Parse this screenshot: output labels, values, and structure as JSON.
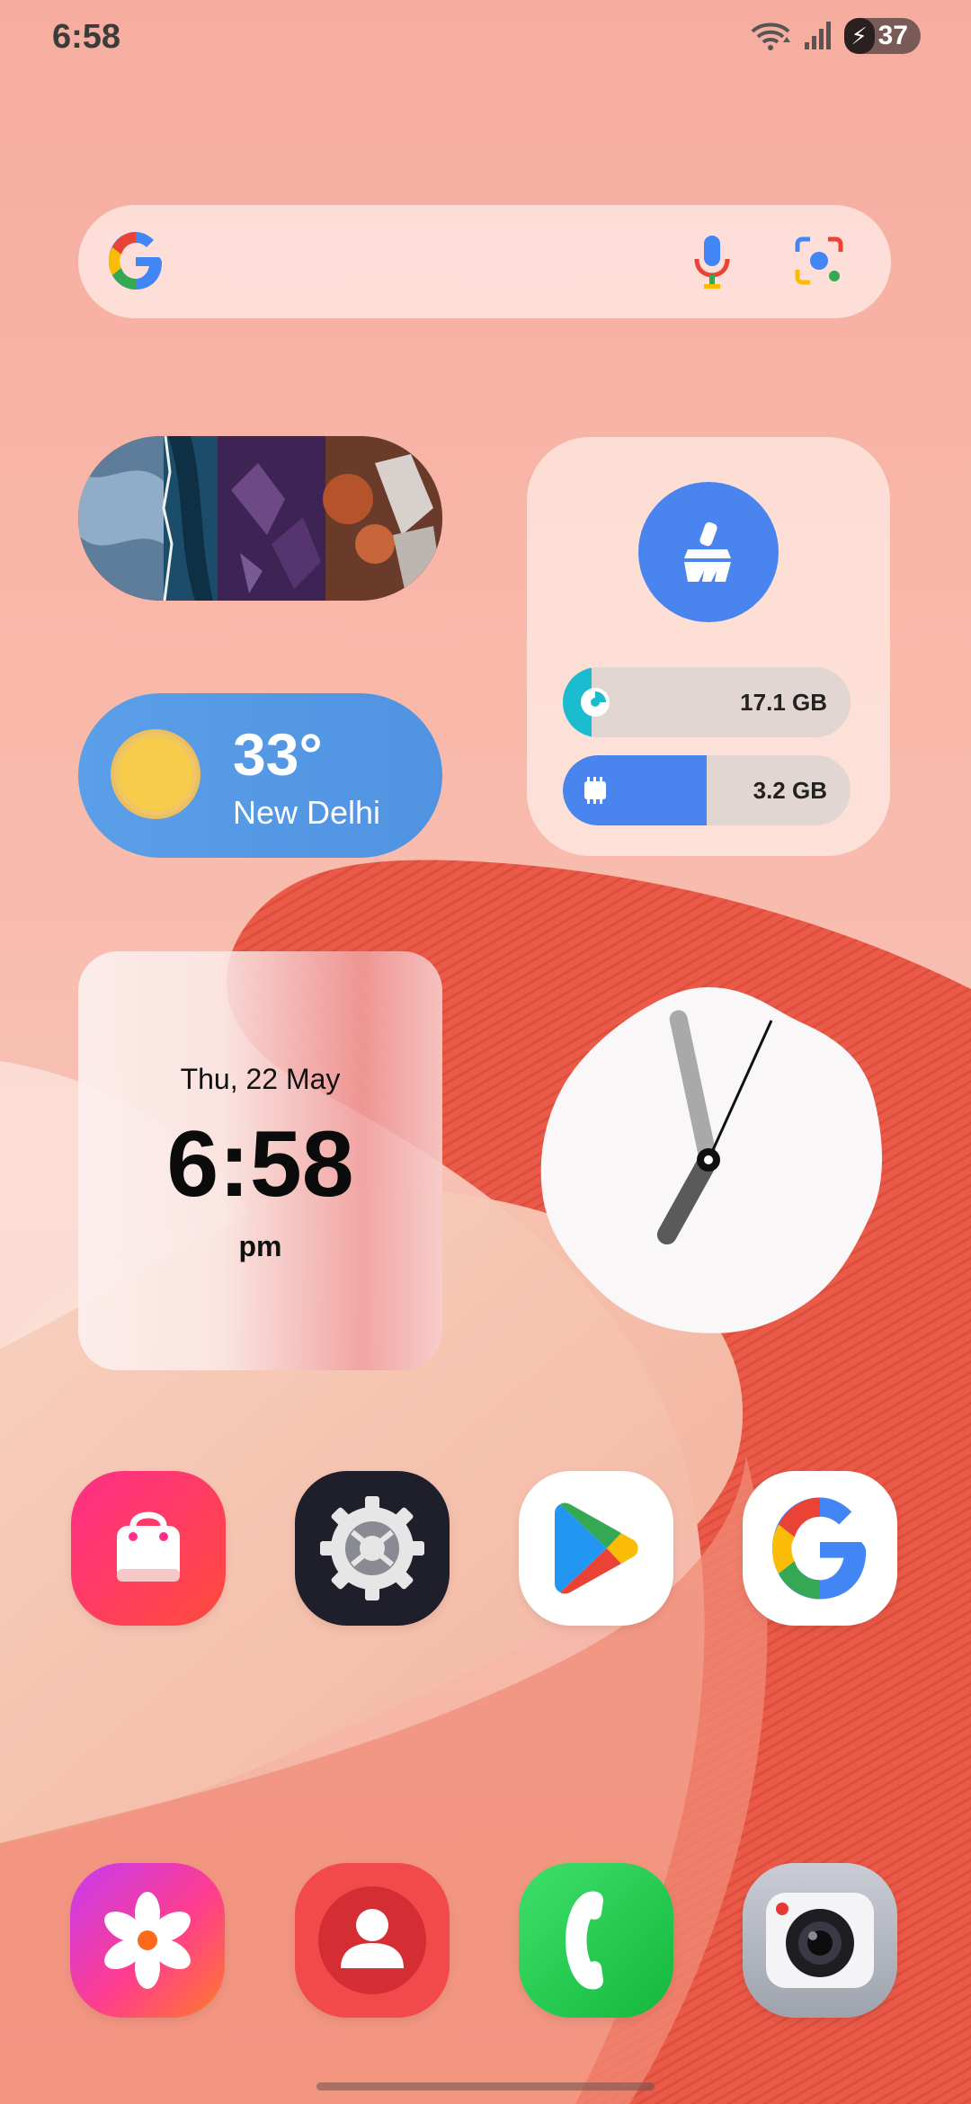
{
  "status_bar": {
    "time": "6:58",
    "battery": "37"
  },
  "search": {
    "brand": "G"
  },
  "weather": {
    "temperature": "33°",
    "city": "New Delhi"
  },
  "cleaner": {
    "storage_label": "17.1 GB",
    "storage_fraction": 0.1,
    "memory_label": "3.2 GB",
    "memory_fraction": 0.5,
    "accent": "#4a84ee"
  },
  "date_widget": {
    "date": "Thu, 22 May",
    "time": "6:58",
    "ampm": "pm"
  },
  "analog_clock": {
    "hour": 6,
    "minute": 58
  },
  "home_apps": [
    {
      "icon": "store-bag-icon"
    },
    {
      "icon": "settings-gear-icon"
    },
    {
      "icon": "play-store-icon"
    },
    {
      "icon": "google-icon"
    }
  ],
  "dock_apps": [
    {
      "icon": "gallery-flower-icon"
    },
    {
      "icon": "contacts-icon"
    },
    {
      "icon": "phone-icon"
    },
    {
      "icon": "camera-icon"
    }
  ]
}
